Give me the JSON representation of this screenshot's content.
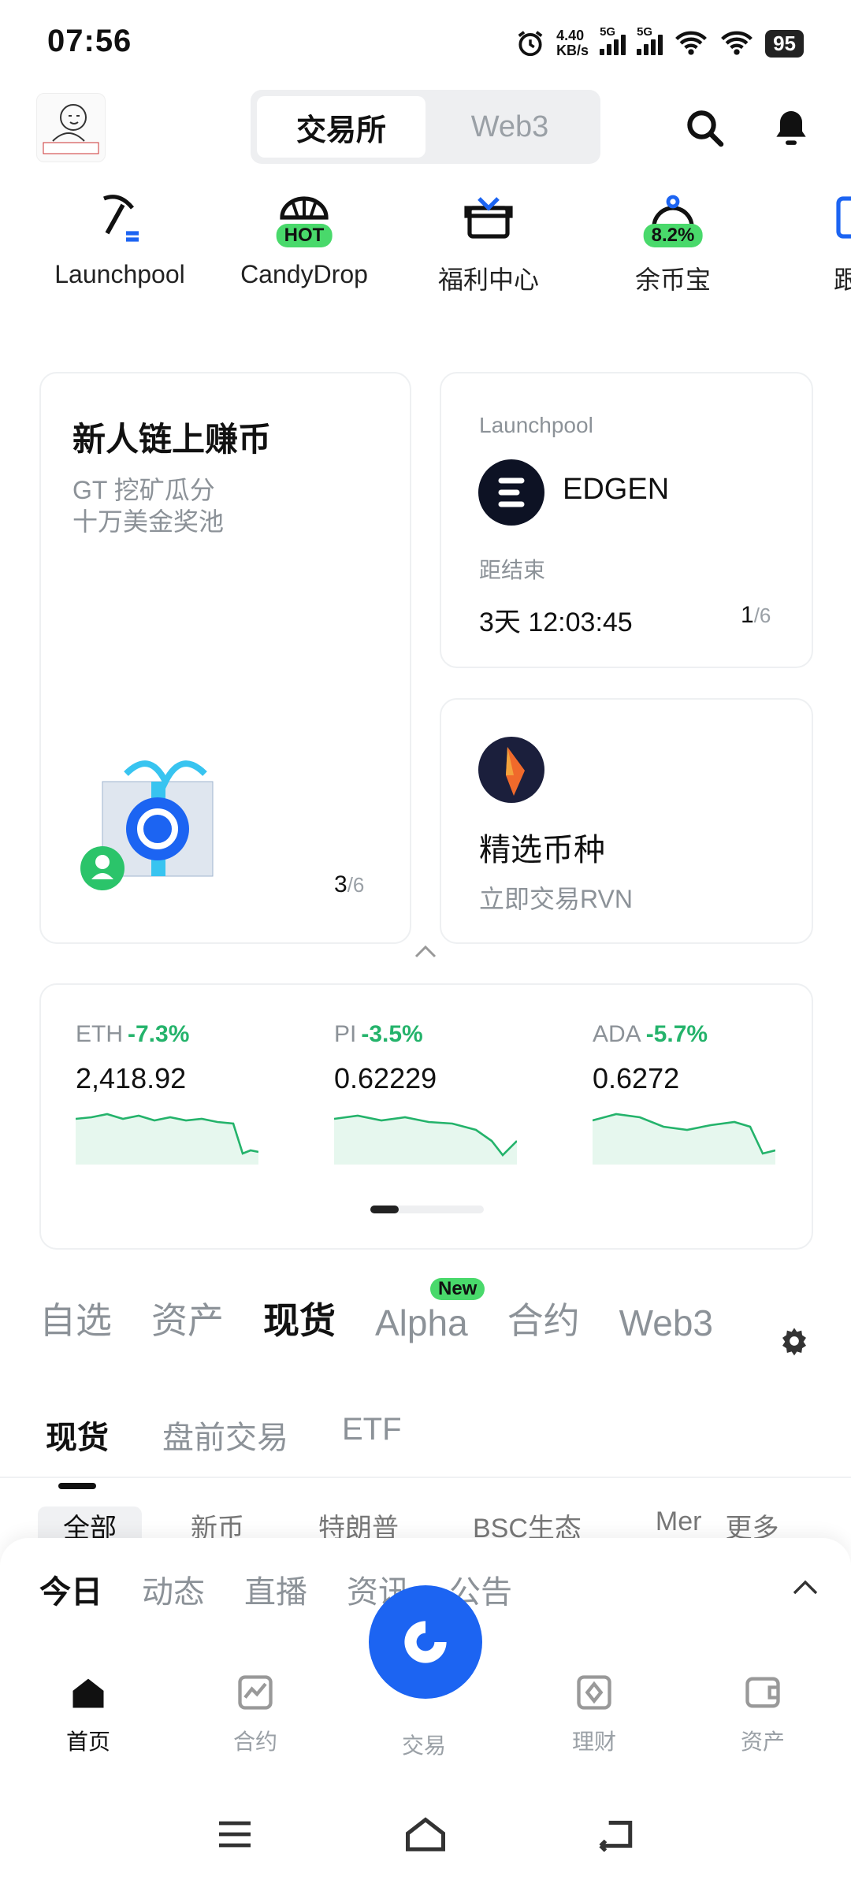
{
  "status_bar": {
    "time": "07:56",
    "net_speed_value": "4.40",
    "net_speed_unit": "KB/s",
    "sim1": "5G",
    "sim2": "5G",
    "battery": "95"
  },
  "header": {
    "segments": [
      "交易所",
      "Web3"
    ],
    "active_segment": "交易所",
    "icons": [
      "avatar",
      "search-icon",
      "bell-icon"
    ]
  },
  "quick_entries": [
    {
      "label": "Launchpool",
      "icon": "pickaxe-icon",
      "badge": ""
    },
    {
      "label": "CandyDrop",
      "icon": "parachute-icon",
      "badge": "HOT"
    },
    {
      "label": "福利中心",
      "icon": "gift-icon",
      "badge": ""
    },
    {
      "label": "余币宝",
      "icon": "piggy-icon",
      "badge": "8.2%"
    },
    {
      "label": "跟",
      "icon": "copy-icon",
      "badge": ""
    }
  ],
  "promo_left": {
    "title": "新人链上赚币",
    "line1": "GT 挖矿瓜分",
    "line2": "十万美金奖池",
    "page_current": "3",
    "page_total": "/6"
  },
  "promo_launchpool": {
    "tag": "Launchpool",
    "token": "EDGEN",
    "countdown_label": "距结束",
    "countdown": "3天 12:03:45",
    "page_current": "1",
    "page_total": "/6"
  },
  "promo_coin": {
    "title": "精选币种",
    "subtitle": "立即交易RVN"
  },
  "market": [
    {
      "name": "ETH",
      "change": "-7.3%",
      "price": "2,418.92"
    },
    {
      "name": "PI",
      "change": "-3.5%",
      "price": "0.62229"
    },
    {
      "name": "ADA",
      "change": "-5.7%",
      "price": "0.6272"
    }
  ],
  "tabs": {
    "items": [
      "自选",
      "资产",
      "现货",
      "Alpha",
      "合约",
      "Web3"
    ],
    "active": "现货",
    "alpha_badge": "New"
  },
  "subtabs": {
    "items": [
      "现货",
      "盘前交易",
      "ETF"
    ],
    "active": "现货"
  },
  "filters": [
    "全部",
    "新币",
    "特朗普",
    "BSC生态",
    "Mer",
    "更多"
  ],
  "news_tabs": {
    "items": [
      "今日",
      "动态",
      "直播",
      "资讯",
      "公告"
    ],
    "active": "今日"
  },
  "bottom_nav": [
    {
      "label": "首页",
      "icon": "home-icon"
    },
    {
      "label": "合约",
      "icon": "futures-icon"
    },
    {
      "label": "交易",
      "icon": "trade-icon"
    },
    {
      "label": "理财",
      "icon": "earn-icon"
    },
    {
      "label": "资产",
      "icon": "wallet-icon"
    }
  ],
  "colors": {
    "accent_blue": "#1c64f2",
    "green": "#24b36b",
    "badge_green": "#49d96b"
  }
}
